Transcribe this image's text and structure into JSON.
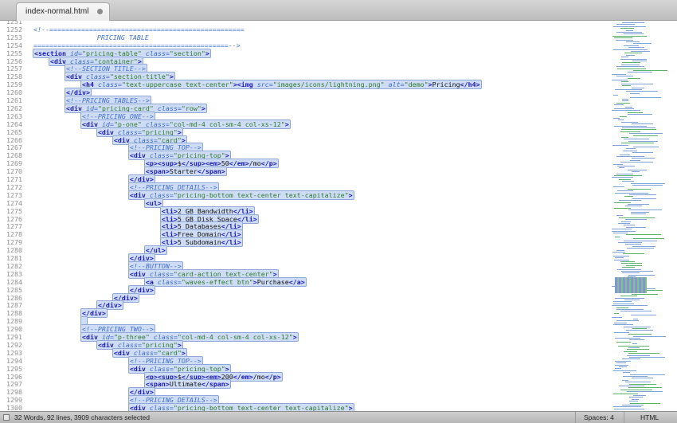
{
  "tab": {
    "title": "index-normal.html"
  },
  "status": {
    "selection": "32 Words, 92 lines, 3909 characters selected",
    "spaces": "Spaces: 4",
    "syntax": "HTML"
  },
  "lines": [
    {
      "n": "1251",
      "html": ""
    },
    {
      "n": "1252",
      "html": "<span class='c'>&lt;!--=================================================</span>",
      "plain": "comment"
    },
    {
      "n": "1253",
      "html": "<span class='c'>                PRICING TABLE</span>"
    },
    {
      "n": "1254",
      "html": "<span class='c'>=================================================--&gt;</span>"
    },
    {
      "n": "1255",
      "html": "<span class='t'>&lt;section</span> <span class='a'>id=</span><span class='v'>\"pricing-table\"</span> <span class='a'>class=</span><span class='v'>\"section\"</span><span class='t'>&gt;</span>"
    },
    {
      "n": "1256",
      "html": "    <span class='t'>&lt;div</span> <span class='a'>class=</span><span class='v'>\"container\"</span><span class='t'>&gt;</span>"
    },
    {
      "n": "1257",
      "html": "        <span class='c'>&lt;!--SECTION TITLE--&gt;</span>"
    },
    {
      "n": "1258",
      "html": "        <span class='t'>&lt;div</span> <span class='a'>class=</span><span class='v'>\"section-title\"</span><span class='t'>&gt;</span>"
    },
    {
      "n": "1259",
      "html": "            <span class='t'>&lt;h4</span> <span class='a'>class=</span><span class='v'>\"text-uppercase text-center\"</span><span class='t'>&gt;&lt;img</span> <span class='a'>src=</span><span class='v'>\"images/icons/lightning.png\"</span> <span class='a'>alt=</span><span class='v'>\"demo\"</span><span class='t'>&gt;</span><span class='txt'>Pricing</span><span class='t'>&lt;/h4&gt;</span>"
    },
    {
      "n": "1260",
      "html": "        <span class='t'>&lt;/div&gt;</span>"
    },
    {
      "n": "1261",
      "html": "        <span class='c'>&lt;!--PRICING TABLES--&gt;</span>"
    },
    {
      "n": "1262",
      "html": "        <span class='t'>&lt;div</span> <span class='a'>id=</span><span class='v'>\"pricing-card\"</span> <span class='a'>class=</span><span class='v'>\"row\"</span><span class='t'>&gt;</span>"
    },
    {
      "n": "1263",
      "html": "            <span class='c'>&lt;!--PRICING ONE--&gt;</span>"
    },
    {
      "n": "1264",
      "html": "            <span class='t'>&lt;div</span> <span class='a'>id=</span><span class='v'>\"p-one\"</span> <span class='a'>class=</span><span class='v'>\"col-md-4 col-sm-4 col-xs-12\"</span><span class='t'>&gt;</span>"
    },
    {
      "n": "1265",
      "html": "                <span class='t'>&lt;div</span> <span class='a'>class=</span><span class='v'>\"pricing\"</span><span class='t'>&gt;</span>"
    },
    {
      "n": "1266",
      "html": "                    <span class='t'>&lt;div</span> <span class='a'>class=</span><span class='v'>\"card\"</span><span class='t'>&gt;</span>"
    },
    {
      "n": "1267",
      "html": "                        <span class='c'>&lt;!--PRICING TOP--&gt;</span>"
    },
    {
      "n": "1268",
      "html": "                        <span class='t'>&lt;div</span> <span class='a'>class=</span><span class='v'>\"pricing-top\"</span><span class='t'>&gt;</span>"
    },
    {
      "n": "1269",
      "html": "                            <span class='t'>&lt;p&gt;&lt;sup&gt;</span><span class='txt'>$</span><span class='t'>&lt;/sup&gt;&lt;em&gt;</span><span class='txt'>50</span><span class='t'>&lt;/em&gt;</span><span class='txt'>/mo</span><span class='t'>&lt;/p&gt;</span>"
    },
    {
      "n": "1270",
      "html": "                            <span class='t'>&lt;span&gt;</span><span class='txt'>Starter</span><span class='t'>&lt;/span&gt;</span>"
    },
    {
      "n": "1271",
      "html": "                        <span class='t'>&lt;/div&gt;</span>"
    },
    {
      "n": "1272",
      "html": "                        <span class='c'>&lt;!--PRICING DETAILS--&gt;</span>"
    },
    {
      "n": "1273",
      "html": "                        <span class='t'>&lt;div</span> <span class='a'>class=</span><span class='v'>\"pricing-bottom text-center text-capitalize\"</span><span class='t'>&gt;</span>"
    },
    {
      "n": "1274",
      "html": "                            <span class='t'>&lt;ul&gt;</span>"
    },
    {
      "n": "1275",
      "html": "                                <span class='t'>&lt;li&gt;</span><span class='txt'>2 GB Bandwidth</span><span class='t'>&lt;/li&gt;</span>"
    },
    {
      "n": "1276",
      "html": "                                <span class='t'>&lt;li&gt;</span><span class='txt'>5 GB Disk Space</span><span class='t'>&lt;/li&gt;</span>"
    },
    {
      "n": "1277",
      "html": "                                <span class='t'>&lt;li&gt;</span><span class='txt'>5 Databases</span><span class='t'>&lt;/li&gt;</span>"
    },
    {
      "n": "1278",
      "html": "                                <span class='t'>&lt;li&gt;</span><span class='txt'>Free Domain</span><span class='t'>&lt;/li&gt;</span>"
    },
    {
      "n": "1279",
      "html": "                                <span class='t'>&lt;li&gt;</span><span class='txt'>5 Subdomain</span><span class='t'>&lt;/li&gt;</span>"
    },
    {
      "n": "1280",
      "html": "                            <span class='t'>&lt;/ul&gt;</span>"
    },
    {
      "n": "1281",
      "html": "                        <span class='t'>&lt;/div&gt;</span>"
    },
    {
      "n": "1282",
      "html": "                        <span class='c'>&lt;!--BUTTON--&gt;</span>"
    },
    {
      "n": "1283",
      "html": "                        <span class='t'>&lt;div</span> <span class='a'>class=</span><span class='v'>\"card-action text-center\"</span><span class='t'>&gt;</span>"
    },
    {
      "n": "1284",
      "html": "                            <span class='t'>&lt;a</span> <span class='a'>class=</span><span class='v'>\"waves-effect btn\"</span><span class='t'>&gt;</span><span class='txt'>Purchase</span><span class='t'>&lt;/a&gt;</span>"
    },
    {
      "n": "1285",
      "html": "                        <span class='t'>&lt;/div&gt;</span>"
    },
    {
      "n": "1286",
      "html": "                    <span class='t'>&lt;/div&gt;</span>"
    },
    {
      "n": "1287",
      "html": "                <span class='t'>&lt;/div&gt;</span>"
    },
    {
      "n": "1288",
      "html": "            <span class='t'>&lt;/div&gt;</span>"
    },
    {
      "n": "1289",
      "html": "            "
    },
    {
      "n": "1290",
      "html": "            <span class='c'>&lt;!--PRICING TWO--&gt;</span>"
    },
    {
      "n": "1291",
      "html": "            <span class='t'>&lt;div</span> <span class='a'>id=</span><span class='v'>\"p-three\"</span> <span class='a'>class=</span><span class='v'>\"col-md-4 col-sm-4 col-xs-12\"</span><span class='t'>&gt;</span>"
    },
    {
      "n": "1292",
      "html": "                <span class='t'>&lt;div</span> <span class='a'>class=</span><span class='v'>\"pricing\"</span><span class='t'>&gt;</span>"
    },
    {
      "n": "1293",
      "html": "                    <span class='t'>&lt;div</span> <span class='a'>class=</span><span class='v'>\"card\"</span><span class='t'>&gt;</span>"
    },
    {
      "n": "1294",
      "html": "                        <span class='c'>&lt;!--PRICING TOP--&gt;</span>"
    },
    {
      "n": "1295",
      "html": "                        <span class='t'>&lt;div</span> <span class='a'>class=</span><span class='v'>\"pricing-top\"</span><span class='t'>&gt;</span>"
    },
    {
      "n": "1296",
      "html": "                            <span class='t'>&lt;p&gt;&lt;sup&gt;</span><span class='txt'>$</span><span class='t'>&lt;/sup&gt;&lt;em&gt;</span><span class='txt'>200</span><span class='t'>&lt;/em&gt;</span><span class='txt'>/mo</span><span class='t'>&lt;/p&gt;</span>"
    },
    {
      "n": "1297",
      "html": "                            <span class='t'>&lt;span&gt;</span><span class='txt'>Ultimate</span><span class='t'>&lt;/span&gt;</span>"
    },
    {
      "n": "1298",
      "html": "                        <span class='t'>&lt;/div&gt;</span>"
    },
    {
      "n": "1299",
      "html": "                        <span class='c'>&lt;!--PRICING DETAILS--&gt;</span>"
    },
    {
      "n": "1300",
      "html": "                        <span class='t'>&lt;div</span> <span class='a'>class=</span><span class='v'>\"pricing-bottom text-center text-capitalize\"</span><span class='t'>&gt;</span>"
    }
  ]
}
